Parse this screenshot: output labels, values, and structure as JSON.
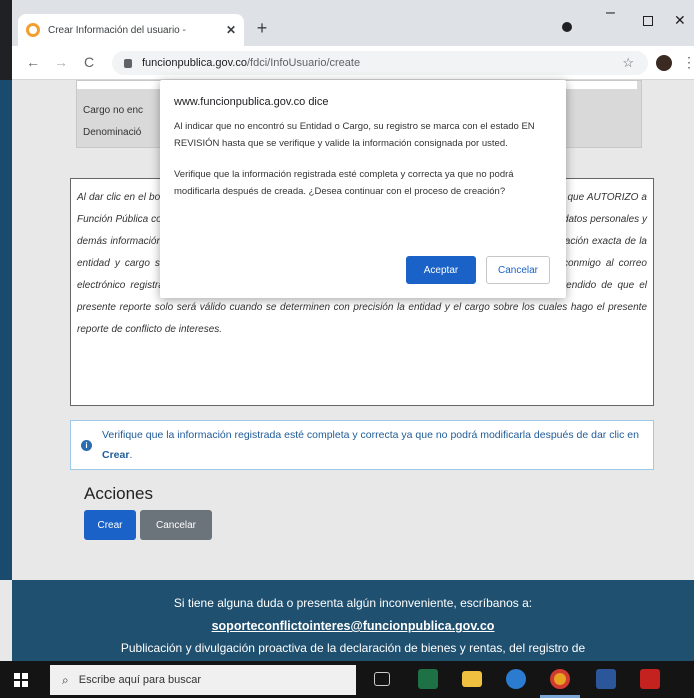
{
  "browser": {
    "tab_title": "Crear Información del usuario - ",
    "tab_close": "✕",
    "new_tab": "+",
    "url_host": "funcionpublica.gov.co",
    "url_path": "/fdci/InfoUsuario/create",
    "star": "☆",
    "menu": "⋮",
    "back": "←",
    "forward": "→",
    "reload": "C",
    "win_min": "–",
    "win_close": "✕"
  },
  "form": {
    "cargo_label": "Cargo no enc",
    "denominacion_label": "Denominació",
    "disclaimer_text": "Al dar clic en el botón Crear, declaro bajo la gravedad de juramento, que la información registrada es veraz y que AUTORIZO a Función Pública como responsable del tratamiento, la recolección, almacenamiento, uso y circulación de mis datos personales y demás información suministrada en el presente reporte; de igual forma, con el propósito de lograr la identificación exacta de la entidad y cargo sobre los cuales realizo el presente reporte, autorizo al DAFP a ponerse en contacto conmigo al correo electrónico registrado, en caso de requerir ampliar, corregir, ajustar o modificar la información en el entendido de que el presente reporte solo será válido cuando se determinen con precisión la entidad y el cargo sobre los cuales hago el presente reporte de conflicto de intereses.",
    "info_icon": "i",
    "info_text": "Verifique que la información registrada esté completa y correcta ya que no podrá modificarla después de dar clic en ",
    "info_bold": "Crear",
    "info_end": ".",
    "acciones_title": "Acciones",
    "crear_label": "Crear",
    "cancelar_label": "Cancelar"
  },
  "footer": {
    "line1": "Si tiene alguna duda o presenta algún inconveniente, escríbanos a:",
    "email": "soporteconflictointeres@funcionpublica.gov.co",
    "line3": "Publicación y divulgación proactiva de la declaración de bienes y rentas, del registro de"
  },
  "dialog": {
    "title": "www.funcionpublica.gov.co dice",
    "message1": "Al indicar que no encontró su Entidad o Cargo, su registro se marca con el estado EN REVISIÓN hasta que se verifique y valide la información consignada por usted.",
    "message2": "Verifique que la información registrada esté completa y correcta ya que no podrá modificarla después de creada. ¿Desea continuar con el proceso de creación?",
    "accept_label": "Aceptar",
    "cancel_label": "Cancelar"
  },
  "taskbar": {
    "search_placeholder": "Escribe aquí para buscar",
    "search_icon": "⌕",
    "icons": [
      "task-view-icon",
      "excel-icon",
      "file-explorer-icon",
      "edge-icon",
      "chrome-icon",
      "word-icon",
      "acrobat-icon"
    ]
  },
  "colors": {
    "primary_button": "#1a62c8",
    "secondary_button": "#6b737b",
    "footer_bg": "#20506f",
    "info_text": "#1f5c99"
  }
}
